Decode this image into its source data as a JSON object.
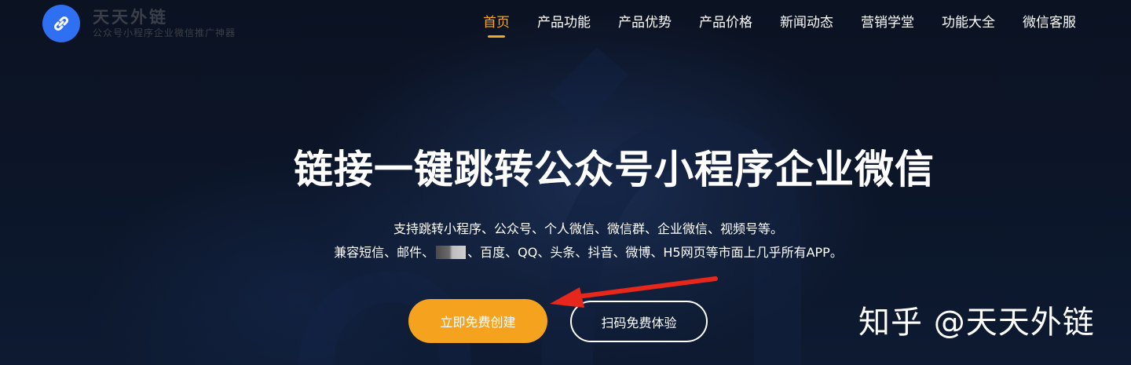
{
  "brand": {
    "name": "天天外链",
    "slogan": "公众号小程序企业微信推广神器",
    "logo_color": "#2f6ff2"
  },
  "nav": {
    "items": [
      {
        "label": "首页",
        "active": true
      },
      {
        "label": "产品功能"
      },
      {
        "label": "产品优势"
      },
      {
        "label": "产品价格"
      },
      {
        "label": "新闻动态"
      },
      {
        "label": "营销学堂"
      },
      {
        "label": "功能大全"
      },
      {
        "label": "微信客服"
      }
    ],
    "active_color": "#f5a623"
  },
  "hero": {
    "headline": "链接一键跳转公众号小程序企业微信",
    "line1": "支持跳转小程序、公众号、个人微信、微信群、企业微信、视频号等。",
    "line2_before": "兼容短信、邮件、",
    "line2_after": "、百度、QQ、头条、抖音、微博、H5网页等市面上几乎所有APP。",
    "primary_button": "立即免费创建",
    "secondary_button": "扫码免费体验",
    "primary_color": "#f5a31e"
  },
  "annotation": {
    "arrow_color": "#e8271c"
  },
  "watermark": {
    "text": "知乎 @天天外链"
  },
  "icons": {
    "logo": "link-icon",
    "blurred": "redacted-block"
  }
}
